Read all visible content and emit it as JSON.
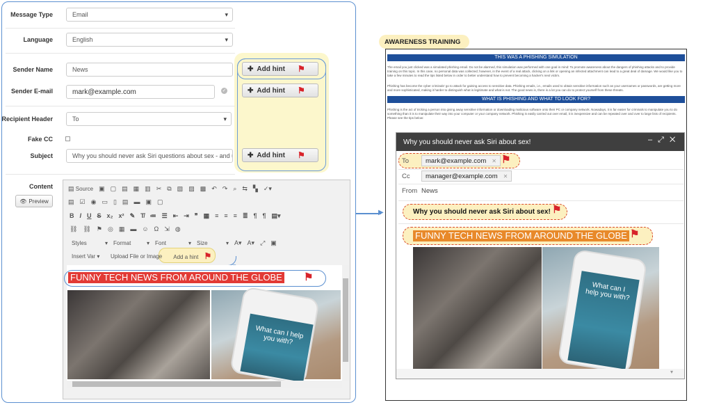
{
  "form": {
    "message_type": {
      "label": "Message Type",
      "value": "Email"
    },
    "language": {
      "label": "Language",
      "value": "English"
    },
    "sender_name": {
      "label": "Sender Name",
      "value": "News"
    },
    "sender_email": {
      "label": "Sender E-mail",
      "value": "mark@example.com"
    },
    "recipient_header": {
      "label": "Recipient Header",
      "value": "To"
    },
    "fake_cc": {
      "label": "Fake CC"
    },
    "subject": {
      "label": "Subject",
      "value": "Why you should never ask Siri questions about sex - and use"
    },
    "content": {
      "label": "Content"
    },
    "preview_label": "Preview",
    "add_hint_label": "Add hint"
  },
  "editor": {
    "source_label": "Source",
    "styles_label": "Styles",
    "format_label": "Format",
    "font_label": "Font",
    "size_label": "Size",
    "insert_var_label": "Insert Var",
    "upload_label": "Upload File or Image",
    "add_a_hint_label": "Add a hint",
    "banner_text": "FUNNY TECH NEWS FROM AROUND THE GLOBE",
    "phone_text": "What can I help you with?"
  },
  "awareness": {
    "title": "AWARENESS TRAINING",
    "bar1": "THIS WAS A PHISHING SIMULATION",
    "para1": "The email you just clicked was a simulated phishing email. Do not be alarmed, this simulation was performed with one goal in mind: To promote awareness about the dangers of phishing attacks and to provide training on this topic. In this case, no personal data was collected; however, in the event of a real attack, clicking on a link or opening an infected attachment can lead to a great deal of damage. We would like you to take a few minutes to read the tips listed below in order to better understand how to prevent becoming a hacker's next victim.",
    "para2": "Phishing has become the cyber criminals' go to attack for gaining access to sensitive data. Phishing emails, i.e., emails used to obtain sensitive information such as your usernames or passwords, are getting more and more sophisticated, making it harder to distinguish what is legitimate and what is not. The good news is, there is a lot you can do to protect yourself from these threats.",
    "bar2": "WHAT IS PHISHING AND WHAT TO LOOK FOR?",
    "para3": "Phishing is the act of tricking a person into giving away sensitive information or downloading malicious software onto their PC or company network. Nowadays, it is far easier for criminals to manipulate you to do something than it is to manipulate their way into your computer or your company network. Phishing is easily carried out over email, it is inexpensive and can be repeated over and over to large lists of recipients. Please see the tips below:"
  },
  "mail": {
    "title": "Why you should never ask Siri about sex!",
    "to_label": "To",
    "to_value": "mark@example.com",
    "cc_label": "Cc",
    "cc_value": "manager@example.com",
    "from_label": "From",
    "from_value": "News",
    "subject": "Why you should never ask Siri about sex!",
    "banner": "FUNNY TECH NEWS FROM AROUND THE GLOBE",
    "phone_text": "What can I help you with?"
  },
  "colors": {
    "accent": "#1e4f9a",
    "flag": "#d8232a",
    "hint_bg": "#fcf7cc",
    "banner": "#e23a35"
  }
}
